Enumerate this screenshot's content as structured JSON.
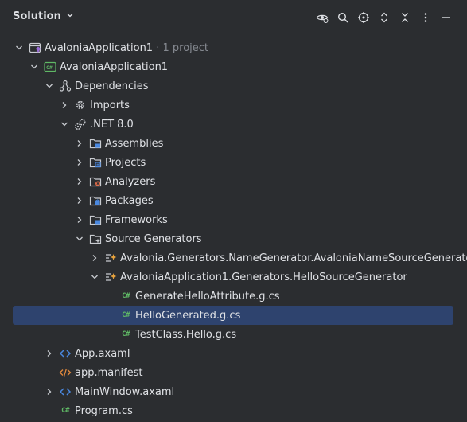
{
  "header": {
    "title": "Solution"
  },
  "toolbar": [
    {
      "name": "eye-settings-icon"
    },
    {
      "name": "search-icon"
    },
    {
      "name": "locate-icon"
    },
    {
      "name": "expand-all-icon"
    },
    {
      "name": "collapse-all-icon"
    },
    {
      "name": "more-icon"
    },
    {
      "name": "minimize-icon"
    }
  ],
  "tree": {
    "solution": {
      "label": "AvaloniaApplication1",
      "suffix": " · 1 project"
    },
    "project": {
      "label": "AvaloniaApplication1"
    },
    "dependencies": {
      "label": "Dependencies"
    },
    "imports": {
      "label": "Imports"
    },
    "net": {
      "label": ".NET 8.0"
    },
    "assemblies": {
      "label": "Assemblies"
    },
    "projects": {
      "label": "Projects"
    },
    "analyzers": {
      "label": "Analyzers"
    },
    "packages": {
      "label": "Packages"
    },
    "frameworks": {
      "label": "Frameworks"
    },
    "source_generators": {
      "label": "Source Generators"
    },
    "name_generator": {
      "label": "Avalonia.Generators.NameGenerator.AvaloniaNameSourceGenerator"
    },
    "hello_generator": {
      "label": "AvaloniaApplication1.Generators.HelloSourceGenerator"
    },
    "file_attr": {
      "label": "GenerateHelloAttribute.g.cs"
    },
    "file_generated": {
      "label": "HelloGenerated.g.cs"
    },
    "file_testclass": {
      "label": "TestClass.Hello.g.cs"
    },
    "app_axaml": {
      "label": "App.axaml"
    },
    "app_manifest": {
      "label": "app.manifest"
    },
    "mainwindow": {
      "label": "MainWindow.axaml"
    },
    "program": {
      "label": "Program.cs"
    }
  },
  "colors": {
    "background": "#2b2d30",
    "selection": "#2e436e",
    "text": "#dfe1e5",
    "muted": "#868a91",
    "csharp_green": "#5fb865"
  }
}
